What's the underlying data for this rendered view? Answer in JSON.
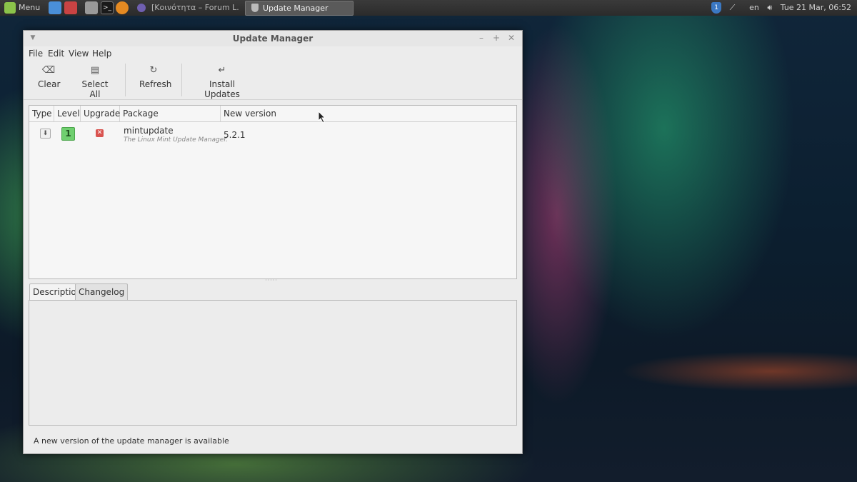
{
  "panel": {
    "menu_label": "Menu",
    "taskbar_items": [
      {
        "label": "[Κοινότητα – Forum L...",
        "active": false
      },
      {
        "label": "Update Manager",
        "active": true
      }
    ],
    "tray": {
      "shield_badge": "1",
      "language": "en",
      "datetime": "Tue 21 Mar, 06:52"
    }
  },
  "window": {
    "title": "Update Manager",
    "menu": [
      "File",
      "Edit",
      "View",
      "Help"
    ],
    "toolbar": {
      "clear": "Clear",
      "select_all": "Select All",
      "refresh": "Refresh",
      "install": "Install Updates"
    },
    "columns": [
      "Type",
      "Level",
      "Upgrade",
      "Package",
      "New version"
    ],
    "updates": [
      {
        "level": "1",
        "package": "mintupdate",
        "description": "The Linux Mint Update Manager.",
        "new_version": "5.2.1",
        "checked": false
      }
    ],
    "tabs": [
      "Description",
      "Changelog"
    ],
    "status": "A new version of the update manager is available"
  },
  "colors": {
    "level_1": "#6fcf6f",
    "unchecked": "#d9534f",
    "panel": "#2b2b2b"
  }
}
